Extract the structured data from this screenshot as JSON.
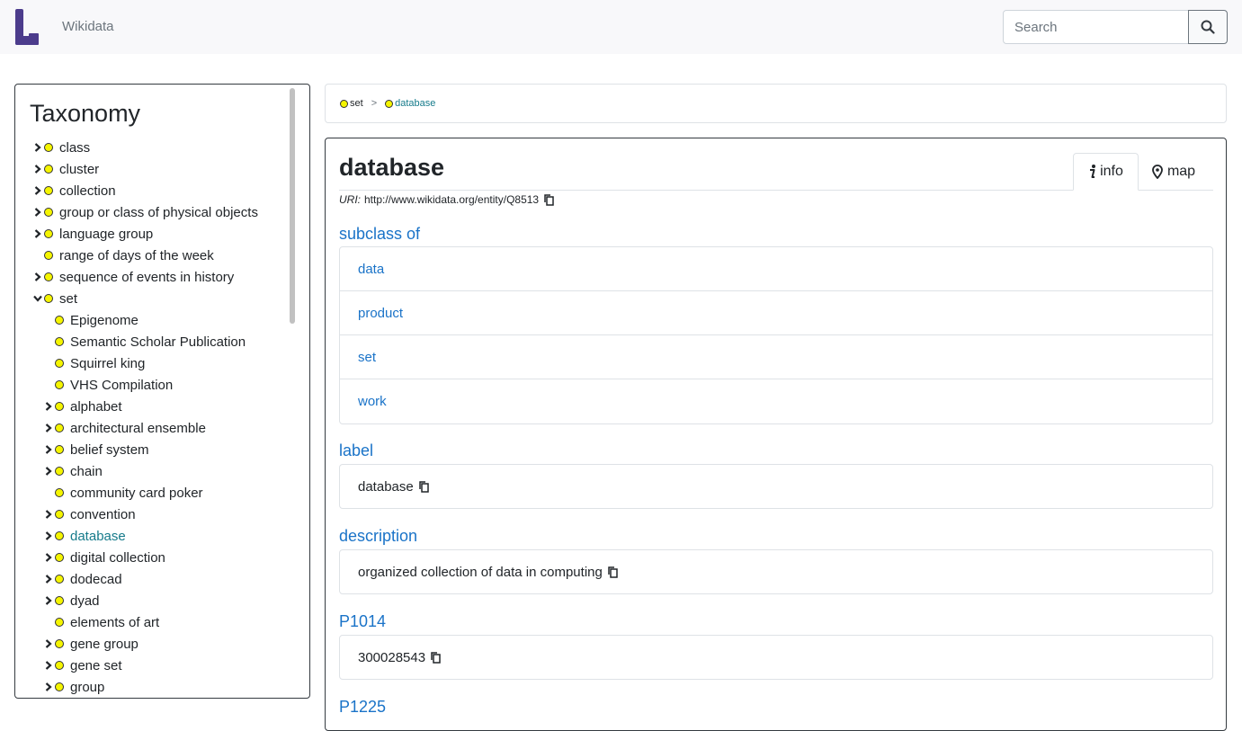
{
  "header": {
    "brand": "Wikidata",
    "search": {
      "placeholder": "Search",
      "value": ""
    },
    "accent_color": "#4c3c8c"
  },
  "sidebar": {
    "title": "Taxonomy",
    "items": [
      {
        "label": "class",
        "level": 0,
        "expander": "collapsed"
      },
      {
        "label": "cluster",
        "level": 0,
        "expander": "collapsed"
      },
      {
        "label": "collection",
        "level": 0,
        "expander": "collapsed"
      },
      {
        "label": "group or class of physical objects",
        "level": 0,
        "expander": "collapsed"
      },
      {
        "label": "language group",
        "level": 0,
        "expander": "collapsed"
      },
      {
        "label": "range of days of the week",
        "level": 0,
        "expander": "none"
      },
      {
        "label": "sequence of events in history",
        "level": 0,
        "expander": "collapsed"
      },
      {
        "label": "set",
        "level": 0,
        "expander": "expanded"
      },
      {
        "label": "Epigenome",
        "level": 1,
        "expander": "none"
      },
      {
        "label": "Semantic Scholar Publication",
        "level": 1,
        "expander": "none"
      },
      {
        "label": "Squirrel king",
        "level": 1,
        "expander": "none"
      },
      {
        "label": "VHS Compilation",
        "level": 1,
        "expander": "none"
      },
      {
        "label": "alphabet",
        "level": 1,
        "expander": "collapsed"
      },
      {
        "label": "architectural ensemble",
        "level": 1,
        "expander": "collapsed"
      },
      {
        "label": "belief system",
        "level": 1,
        "expander": "collapsed"
      },
      {
        "label": "chain",
        "level": 1,
        "expander": "collapsed"
      },
      {
        "label": "community card poker",
        "level": 1,
        "expander": "none"
      },
      {
        "label": "convention",
        "level": 1,
        "expander": "collapsed"
      },
      {
        "label": "database",
        "level": 1,
        "expander": "collapsed",
        "active": true
      },
      {
        "label": "digital collection",
        "level": 1,
        "expander": "collapsed"
      },
      {
        "label": "dodecad",
        "level": 1,
        "expander": "collapsed"
      },
      {
        "label": "dyad",
        "level": 1,
        "expander": "collapsed"
      },
      {
        "label": "elements of art",
        "level": 1,
        "expander": "none"
      },
      {
        "label": "gene group",
        "level": 1,
        "expander": "collapsed"
      },
      {
        "label": "gene set",
        "level": 1,
        "expander": "collapsed"
      },
      {
        "label": "group",
        "level": 1,
        "expander": "collapsed"
      }
    ]
  },
  "breadcrumb": {
    "items": [
      "set",
      "database"
    ],
    "separator": ">"
  },
  "entity": {
    "title": "database",
    "uri_label": "URI:",
    "uri": "http://www.wikidata.org/entity/Q8513",
    "tabs": [
      {
        "label": "info",
        "icon": "info-icon",
        "active": true
      },
      {
        "label": "map",
        "icon": "map-marker-icon",
        "active": false
      }
    ],
    "subclass_heading": "subclass of",
    "subclass_of": [
      "data",
      "product",
      "set",
      "work"
    ],
    "label_heading": "label",
    "label_value": "database",
    "description_heading": "description",
    "description_value": "organized collection of data in computing",
    "p1014_heading": "P1014",
    "p1014_value": "300028543",
    "p1225_heading": "P1225"
  }
}
